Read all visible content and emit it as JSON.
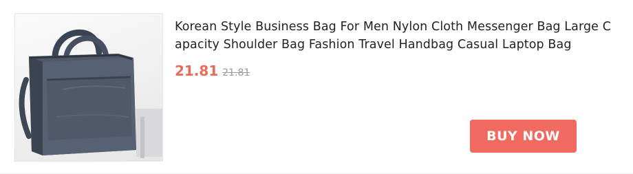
{
  "product": {
    "title": "Korean Style Business Bag For Men Nylon Cloth Messenger Bag Large Capacity Shoulder Bag Fashion Travel Handbag Casual Laptop Bag",
    "price": "21.81",
    "original_price": "21.81",
    "image_icon": "product-photo-icon"
  },
  "actions": {
    "buy_label": "BUY NOW"
  },
  "colors": {
    "accent": "#f06a5f",
    "price": "#e86a5a"
  }
}
